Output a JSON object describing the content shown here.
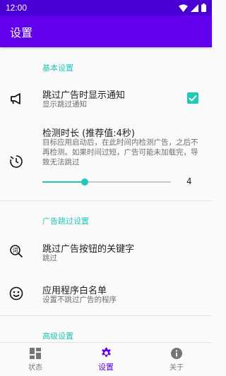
{
  "status_bar": {
    "time": "12:00"
  },
  "app_bar": {
    "title": "设置"
  },
  "sections": {
    "basic": {
      "header": "基本设置"
    },
    "ad_skip": {
      "header": "广告跳过设置"
    },
    "advanced": {
      "header": "高级设置"
    }
  },
  "items": {
    "notify": {
      "title": "跳过广告时显示通知",
      "subtitle": "显示跳过通知",
      "checked": true
    },
    "duration": {
      "title": "检测时长 (推荐值:4秒)",
      "subtitle": "目标应用启动后，在此时间内检测广告，之后不再检测。如果时间过短，广告可能未加载完，导致无法跳过",
      "value": "4",
      "level": 0.33
    },
    "keywords": {
      "title": "跳过广告按钮的关键字",
      "subtitle": "跳过"
    },
    "whitelist": {
      "title": "应用程序白名单",
      "subtitle": "设置不跳过广告的程序"
    }
  },
  "bottom_nav": {
    "status": "状态",
    "settings": "设置",
    "about": "关于",
    "active": "settings"
  },
  "colors": {
    "primary": "#6200ee",
    "status_bar": "#4a00d4",
    "accent": "#1fc8b6"
  }
}
